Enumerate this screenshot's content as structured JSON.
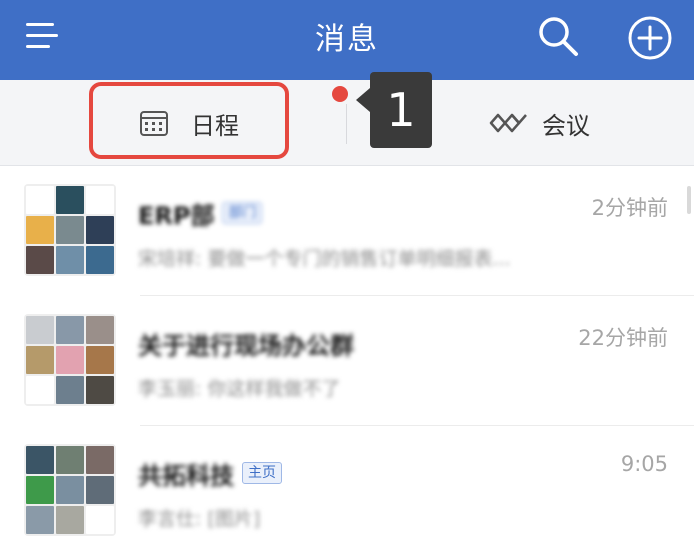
{
  "header": {
    "title": "消息",
    "background": "#3f6fc6",
    "icons": [
      "menu-icon",
      "search-icon",
      "add-icon"
    ]
  },
  "tabs": [
    {
      "label": "日程",
      "icon": "calendar-icon"
    },
    {
      "label": "会议",
      "icon": "meeting-icon"
    }
  ],
  "annotation": {
    "step": "1",
    "highlight_color": "#e5483f"
  },
  "conversations": [
    {
      "name": "ERP部",
      "tag": "部门",
      "time": "2分钟前",
      "preview": "宋培祥: 要做一个专门的销售订单明细报表..."
    },
    {
      "name": "关于进行现场办公群",
      "tag": "",
      "time": "22分钟前",
      "preview": "李玉丽: 你这样我做不了"
    },
    {
      "name": "共拓科技",
      "tag": "主页",
      "time": "9:05",
      "preview": "李言仕: [图片]"
    }
  ]
}
